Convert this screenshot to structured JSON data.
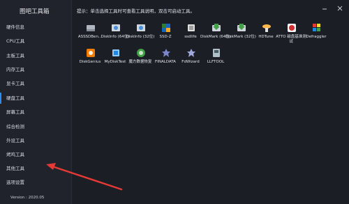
{
  "sidebar": {
    "title": "图吧工具箱",
    "items": [
      {
        "label": "硬件信息"
      },
      {
        "label": "CPU工具"
      },
      {
        "label": "主板工具"
      },
      {
        "label": "内存工具"
      },
      {
        "label": "显卡工具"
      },
      {
        "label": "硬盘工具"
      },
      {
        "label": "屏幕工具"
      },
      {
        "label": "综合检测"
      },
      {
        "label": "外设工具"
      },
      {
        "label": "烤鸡工具"
      },
      {
        "label": "其他工具"
      },
      {
        "label": "选项设置"
      }
    ],
    "version": "Version : 2020.05"
  },
  "main": {
    "hint": "提示：单击选择工具时可查看工具说明，双击可启动工具。",
    "tools_row1": [
      {
        "label": "ASSSDBen...",
        "icon": "drive-icon"
      },
      {
        "label": "DiskInfo (64位)",
        "icon": "diskinfo-icon"
      },
      {
        "label": "DiskInfo (32位)",
        "icon": "diskinfo-icon"
      },
      {
        "label": "SSD-Z",
        "icon": "ssdz-icon"
      },
      {
        "label": "ssdlife",
        "icon": "ssdlife-icon"
      },
      {
        "label": "DiskMark (64位)",
        "icon": "diskmark-icon"
      },
      {
        "label": "DiskMark (32位)",
        "icon": "diskmark-icon"
      },
      {
        "label": "HDTune",
        "icon": "hdtune-icon"
      },
      {
        "label": "ATTO 磁盘基准测试",
        "icon": "atto-icon"
      },
      {
        "label": "Defraggler",
        "icon": "defraggler-icon"
      }
    ],
    "tools_row2": [
      {
        "label": "DiskGenius",
        "icon": "diskgenius-icon"
      },
      {
        "label": "MyDiskTest",
        "icon": "mydisktest-icon"
      },
      {
        "label": "魔方数据恢复",
        "icon": "recovery-icon"
      },
      {
        "label": "FINALDATA",
        "icon": "finaldata-icon"
      },
      {
        "label": "FdWizard",
        "icon": "fdwizard-icon"
      },
      {
        "label": "LLFTOOL",
        "icon": "llftool-icon"
      }
    ]
  },
  "colors": {
    "accent": "#2d8cf0",
    "arrow": "#e53935"
  }
}
